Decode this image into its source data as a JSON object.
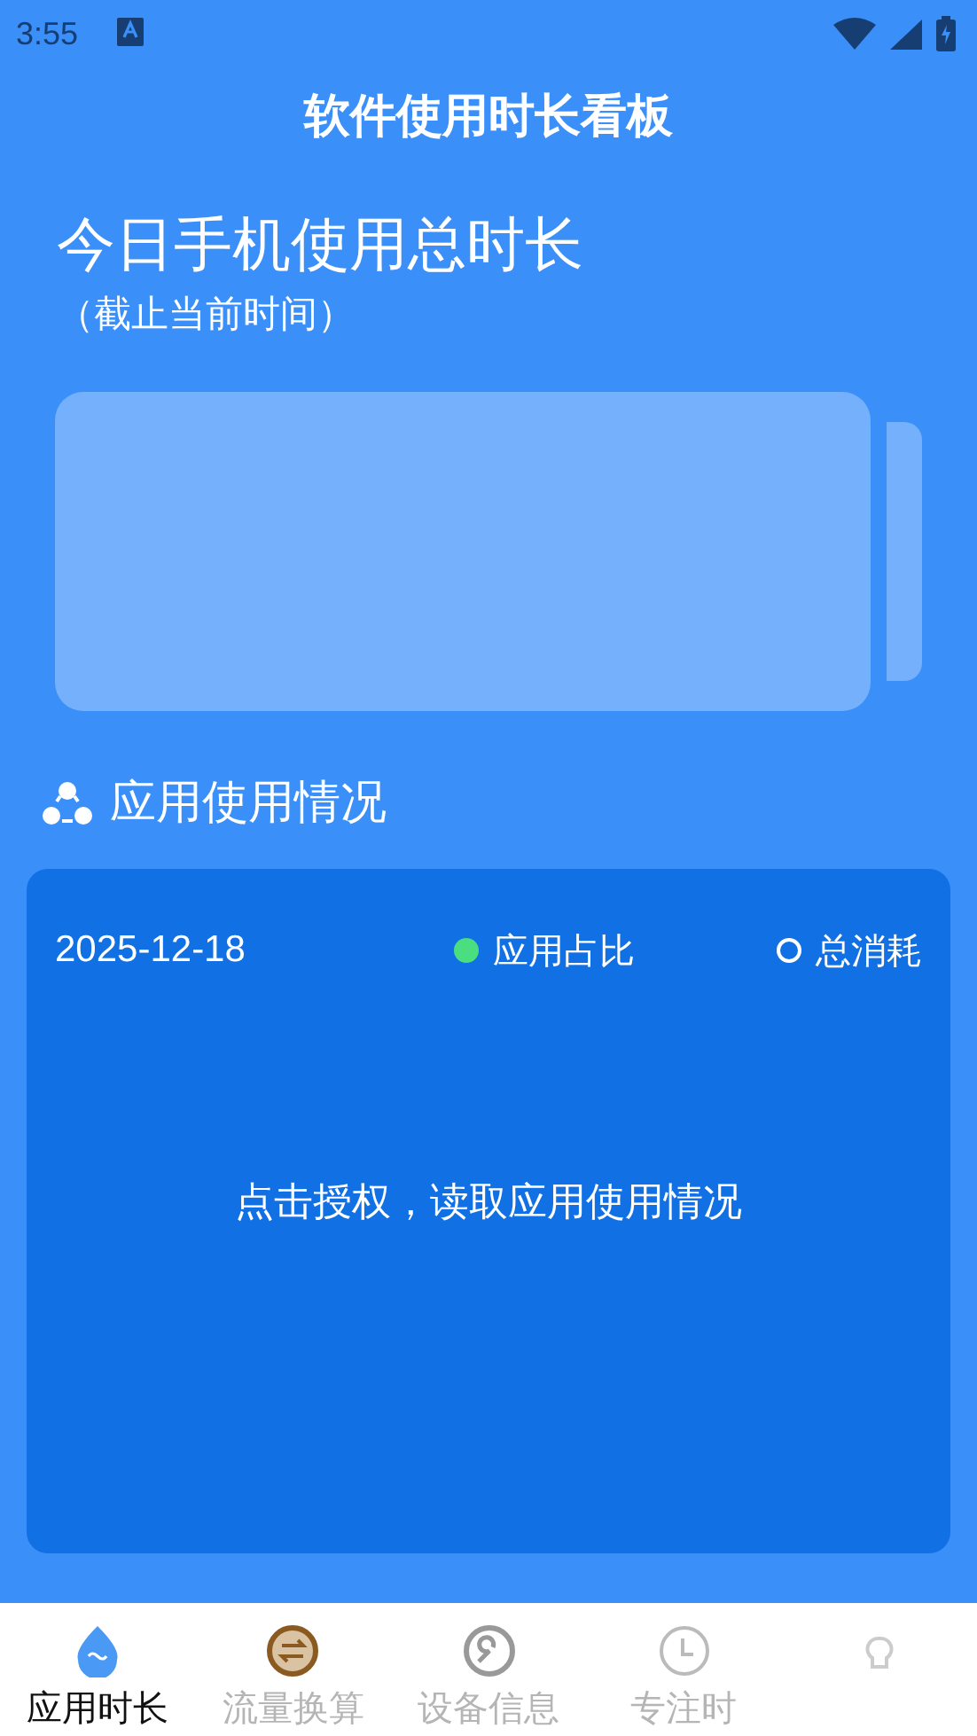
{
  "status_bar": {
    "time": "3:55"
  },
  "header": {
    "title": "软件使用时长看板"
  },
  "today": {
    "title": "今日手机使用总时长",
    "subtitle": "（截止当前时间）"
  },
  "section": {
    "title": "应用使用情况"
  },
  "card": {
    "date": "2025-12-18",
    "legend": [
      {
        "label": "应用占比",
        "selected": true
      },
      {
        "label": "总消耗",
        "selected": false
      }
    ],
    "message": "点击授权，读取应用使用情况"
  },
  "nav": [
    {
      "label": "应用时长",
      "selected": true
    },
    {
      "label": "流量换算",
      "selected": false
    },
    {
      "label": "设备信息",
      "selected": false
    },
    {
      "label": "专注时",
      "selected": false
    },
    {
      "selected": false
    }
  ]
}
